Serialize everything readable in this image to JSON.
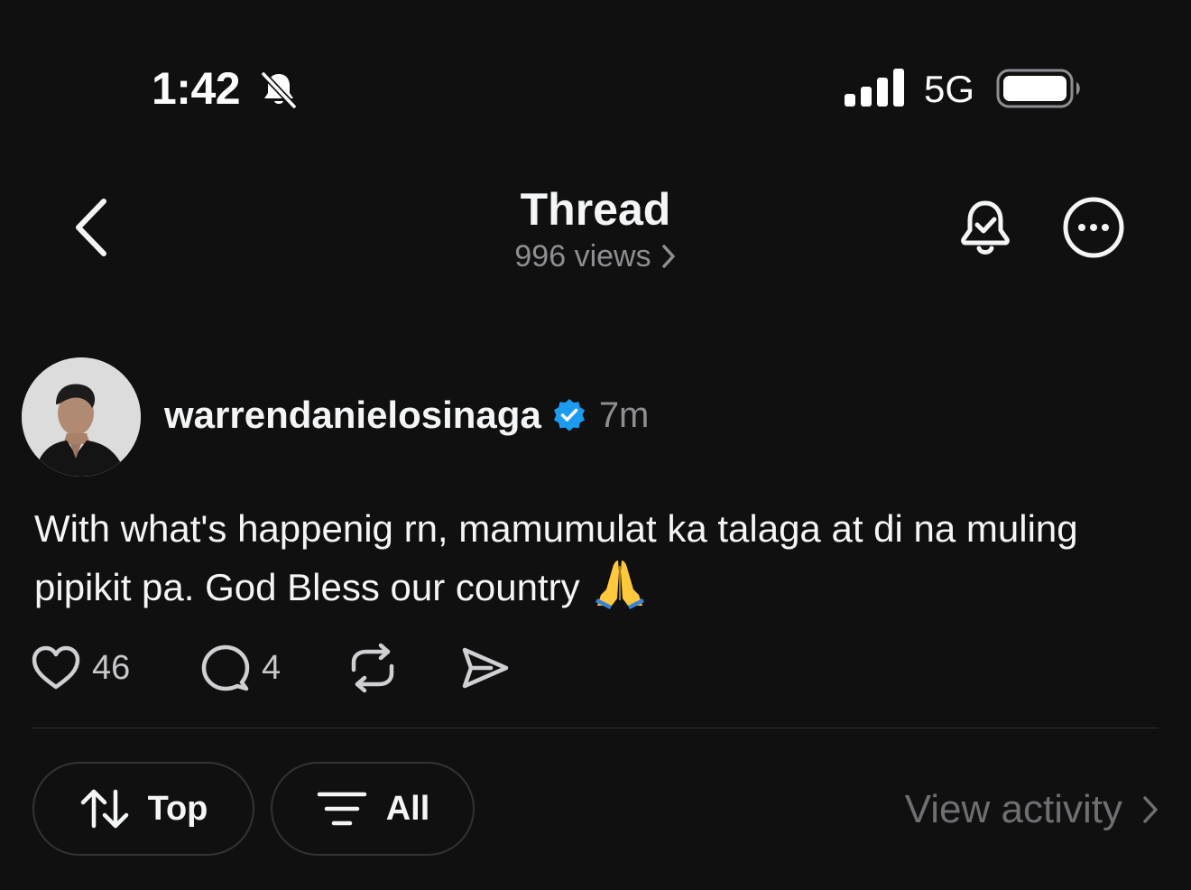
{
  "status_bar": {
    "time": "1:42",
    "network": "5G",
    "icons": [
      "bell-slash-icon",
      "signal-bars-icon",
      "battery-icon"
    ]
  },
  "header": {
    "title": "Thread",
    "views": "996 views",
    "icons": [
      "chevron-left-icon",
      "bell-check-icon",
      "more-circle-icon"
    ]
  },
  "post": {
    "username": "warrendanielosinaga",
    "verified": true,
    "time": "7m",
    "text": "With what's happenig rn, mamumulat ka talaga at di na muling pipikit pa. God Bless our country",
    "emoji": "🙏",
    "likes": "46",
    "replies": "4",
    "action_icons": [
      "heart-icon",
      "comment-icon",
      "repost-icon",
      "share-icon"
    ]
  },
  "filters": {
    "sort_label": "Top",
    "filter_label": "All",
    "view_activity": "View activity"
  },
  "colors": {
    "background": "#101010",
    "text_primary": "#f3f5f7",
    "text_secondary": "#8e8e93",
    "verified_blue": "#1d9bf0",
    "border": "#333333"
  }
}
